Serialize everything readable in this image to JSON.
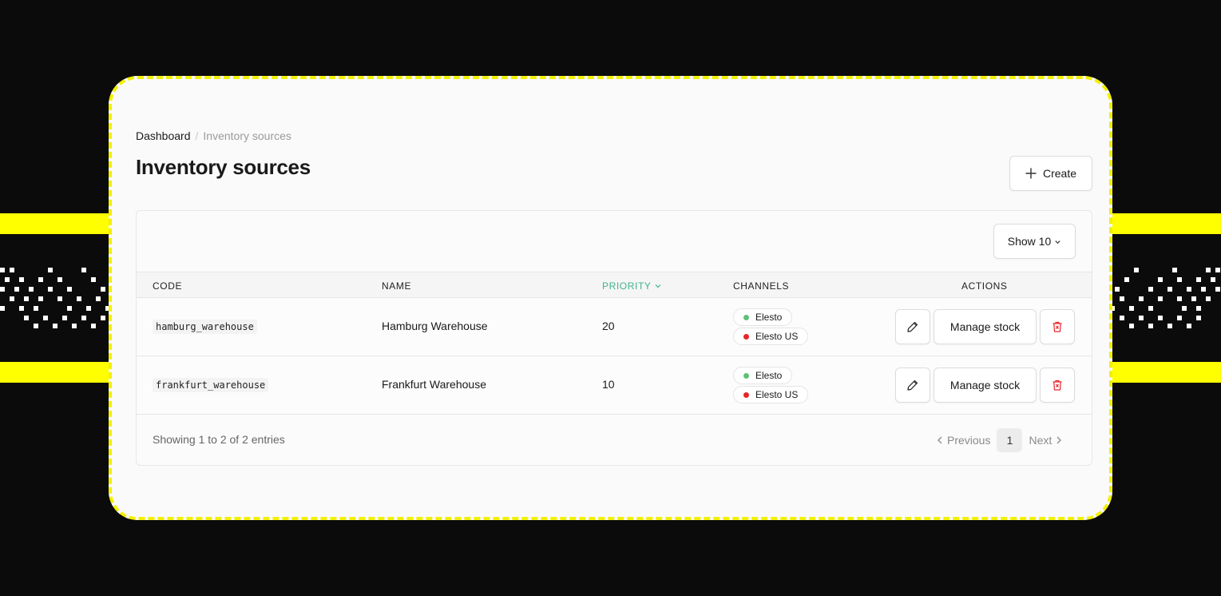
{
  "breadcrumb": {
    "root": "Dashboard",
    "separator": "/",
    "current": "Inventory sources"
  },
  "page": {
    "title": "Inventory sources"
  },
  "toolbar": {
    "create_label": "Create"
  },
  "table_controls": {
    "show_label": "Show 10"
  },
  "columns": {
    "code": "CODE",
    "name": "NAME",
    "priority": "PRIORITY",
    "channels": "CHANNELS",
    "actions": "ACTIONS"
  },
  "rows": [
    {
      "code": "hamburg_warehouse",
      "name": "Hamburg Warehouse",
      "priority": "20",
      "channels": [
        {
          "label": "Elesto",
          "status_color": "#5fc07a"
        },
        {
          "label": "Elesto US",
          "status_color": "#e5262b"
        }
      ],
      "manage_label": "Manage stock"
    },
    {
      "code": "frankfurt_warehouse",
      "name": "Frankfurt Warehouse",
      "priority": "10",
      "channels": [
        {
          "label": "Elesto",
          "status_color": "#5fc07a"
        },
        {
          "label": "Elesto US",
          "status_color": "#e5262b"
        }
      ],
      "manage_label": "Manage stock"
    }
  ],
  "footer": {
    "summary": "Showing 1 to 2 of 2 entries"
  },
  "pagination": {
    "previous_label": "Previous",
    "current_page": "1",
    "next_label": "Next"
  },
  "colors": {
    "accent": "#3fb489",
    "danger": "#e5262b",
    "frame_border": "#f3f000",
    "background": "#0b0b0c"
  },
  "icons": {
    "create": "plus-icon",
    "sort": "chevron-down-icon",
    "edit": "pencil-icon",
    "delete": "trash-icon",
    "prev": "chevron-left-icon",
    "next": "chevron-right-icon"
  }
}
